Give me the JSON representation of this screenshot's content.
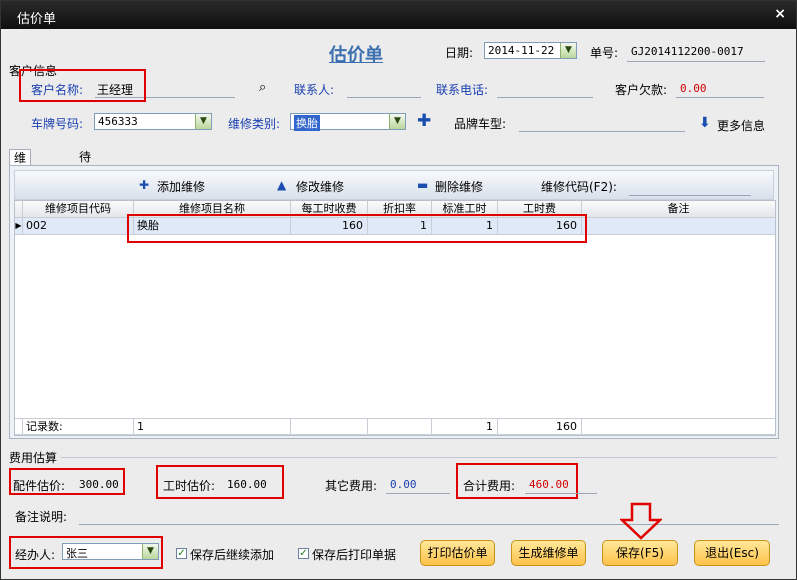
{
  "window": {
    "title": "估价单",
    "close_glyph": "×"
  },
  "header": {
    "section_label": "客户信息",
    "form_title": "估价单",
    "date_label": "日期:",
    "date_value": "2014-11-22",
    "order_no_label": "单号:",
    "order_no_value": "GJ2014112200-0017"
  },
  "customer": {
    "name_label": "客户名称:",
    "name_value": "王经理",
    "contact_label": "联系人:",
    "contact_value": "",
    "phone_label": "联系电话:",
    "phone_value": "",
    "debt_label": "客户欠款:",
    "debt_value": "0.00",
    "plate_label": "车牌号码:",
    "plate_value": "456333",
    "repair_type_label": "维修类别:",
    "repair_type_value": "换胎",
    "model_label": "品牌车型:",
    "model_value": "",
    "more_info_label": "更多信息"
  },
  "tabs": [
    {
      "label": "维修项目"
    },
    {
      "label": "待换配件"
    }
  ],
  "toolbar": {
    "add_label": "添加维修",
    "edit_label": "修改维修",
    "delete_label": "删除维修",
    "code_label": "维修代码(F2):"
  },
  "grid": {
    "columns": [
      "维修项目代码",
      "维修项目名称",
      "每工时收费",
      "折扣率",
      "标准工时",
      "工时费",
      "备注"
    ],
    "rows": [
      {
        "code": "002",
        "name": "换胎",
        "rate": "160",
        "discount": "1",
        "hours": "1",
        "fee": "160",
        "note": ""
      }
    ],
    "footer": {
      "label": "记录数:",
      "count": "1",
      "hours": "1",
      "fee": "160"
    }
  },
  "cost": {
    "section_label": "费用估算",
    "parts_label": "配件估价:",
    "parts_value": "300.00",
    "labor_label": "工时估价:",
    "labor_value": "160.00",
    "other_label": "其它费用:",
    "other_value": "0.00",
    "total_label": "合计费用:",
    "total_value": "460.00",
    "remark_label": "备注说明:",
    "remark_value": ""
  },
  "footer": {
    "handler_label": "经办人:",
    "handler_value": "张三",
    "chk_continue_label": "保存后继续添加",
    "chk_print_label": "保存后打印单据",
    "print_btn": "打印估价单",
    "generate_btn": "生成维修单",
    "save_btn": "保存(F5)",
    "exit_btn": "退出(Esc)"
  },
  "colors": {
    "accent_blue": "#1a3fb0",
    "highlight_red": "#e00000",
    "button_orange": "#ffc24a"
  }
}
